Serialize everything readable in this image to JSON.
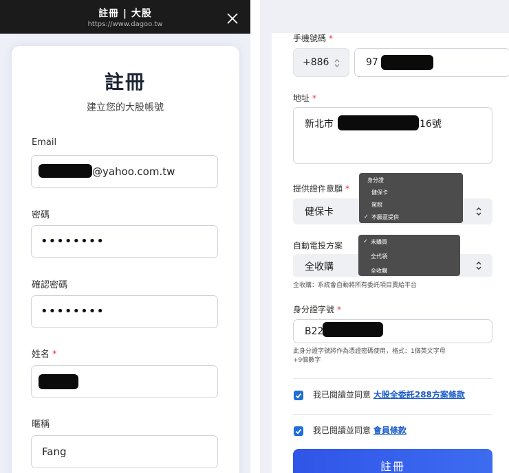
{
  "left": {
    "topbar": {
      "title": "註冊 | 大股",
      "url": "https://www.dagoo.tw"
    },
    "heading": "註冊",
    "subtitle": "建立您的大股帳號",
    "fields": {
      "email_label": "Email",
      "email_visible_value": "@yahoo.com.tw",
      "password_label": "密碼",
      "password_dots": "••••••••",
      "confirm_label": "確認密碼",
      "confirm_dots": "••••••••",
      "name_label": "姓名",
      "required_mark": "*",
      "nickname_label": "暱稱",
      "nickname_value": "Fang"
    }
  },
  "right": {
    "phone_label": "手機號碼",
    "country_code": "+886",
    "phone_prefix": "97",
    "address_label": "地址",
    "address_prefix": "新北市",
    "address_suffix": "16號",
    "id_doc_label": "提供證件意願",
    "id_doc_selected": "健保卡",
    "id_doc_menu": [
      "身分證",
      "健保卡",
      "駕照",
      "不願意提供"
    ],
    "id_doc_checked_index": 3,
    "auto_vote_label": "自動電投方案",
    "auto_vote_selected": "全收購",
    "auto_vote_menu": [
      "未購買",
      "全代領",
      "全收購"
    ],
    "auto_vote_checked_index": 0,
    "auto_vote_hint": "全收購：系統會自動將所有委託項目賣給平台",
    "id_number_label": "身分證字號",
    "id_number_prefix": "B22",
    "id_number_hint_line1": "此身分證字號將作為憑證密碼使用，格式：1個英文字母",
    "id_number_hint_line2": "+9個數字",
    "agree_prefix": "我已閱讀並同意",
    "agree1_link": "大股全委託288方案條款",
    "agree2_link": "會員條款",
    "submit_label": "註冊",
    "required_mark": "*",
    "check_mark": "✓"
  },
  "colors": {
    "accent": "#1f6fd6",
    "link": "#1a5cc8",
    "required": "#e23a3a",
    "button": "#2f55e8"
  }
}
